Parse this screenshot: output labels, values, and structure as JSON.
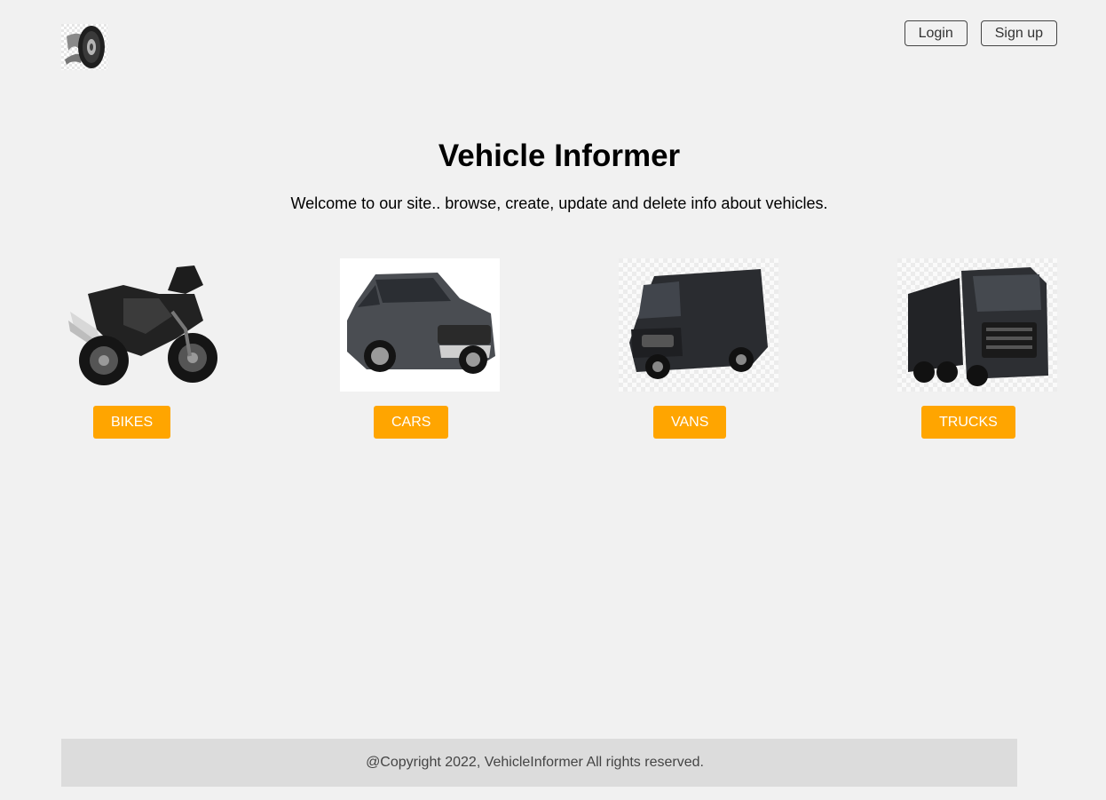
{
  "header": {
    "logo_icon": "tire-icon",
    "login_label": "Login",
    "signup_label": "Sign up"
  },
  "hero": {
    "title": "Vehicle Informer",
    "subtitle": "Welcome to our site.. browse, create, update and delete info about vehicles."
  },
  "categories": [
    {
      "label": "BIKES",
      "image": "motorcycle-image"
    },
    {
      "label": "CARS",
      "image": "car-image"
    },
    {
      "label": "VANS",
      "image": "van-image"
    },
    {
      "label": "TRUCKS",
      "image": "truck-image"
    }
  ],
  "footer": {
    "copyright": "@Copyright 2022, VehicleInformer All rights reserved."
  },
  "colors": {
    "background": "#f1f1f1",
    "accent": "#ffa500",
    "footer_bg": "#dcdcdc"
  }
}
